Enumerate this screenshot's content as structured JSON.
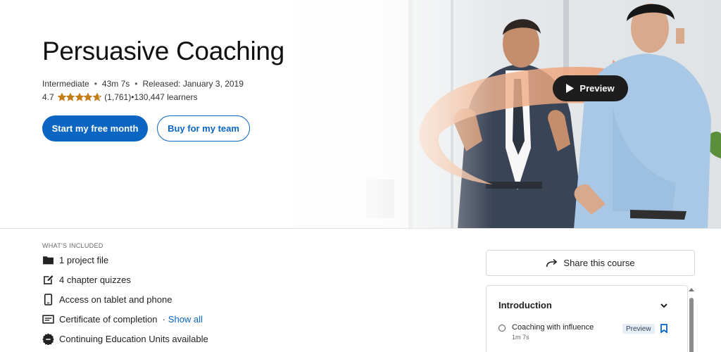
{
  "course": {
    "title": "Persuasive Coaching",
    "level": "Intermediate",
    "duration": "43m 7s",
    "released": "Released: January 3, 2019",
    "rating": "4.7",
    "rating_value": 4.7,
    "reviews": "(1,761)",
    "learners": "130,447 learners"
  },
  "actions": {
    "primary": "Start my free month",
    "secondary": "Buy for my team",
    "preview": "Preview"
  },
  "included": {
    "heading": "WHAT'S INCLUDED",
    "items": [
      {
        "label": "1 project file",
        "icon": "folder-icon"
      },
      {
        "label": "4 chapter quizzes",
        "icon": "edit-icon"
      },
      {
        "label": "Access on tablet and phone",
        "icon": "tablet-icon"
      },
      {
        "label": "Certificate of completion",
        "icon": "certificate-icon"
      },
      {
        "label": "Continuing Education Units available",
        "icon": "badge-icon"
      }
    ],
    "separator": "·",
    "show_all": "Show all"
  },
  "sidebar": {
    "share": "Share this course",
    "toc": {
      "chapter": "Introduction",
      "lessons": [
        {
          "title": "Coaching with influence",
          "time": "1m 7s",
          "tag": "Preview"
        }
      ]
    }
  },
  "colors": {
    "brand_blue": "#0a66c2",
    "star": "#c37d16",
    "preview_bg": "#1d1d1d"
  }
}
